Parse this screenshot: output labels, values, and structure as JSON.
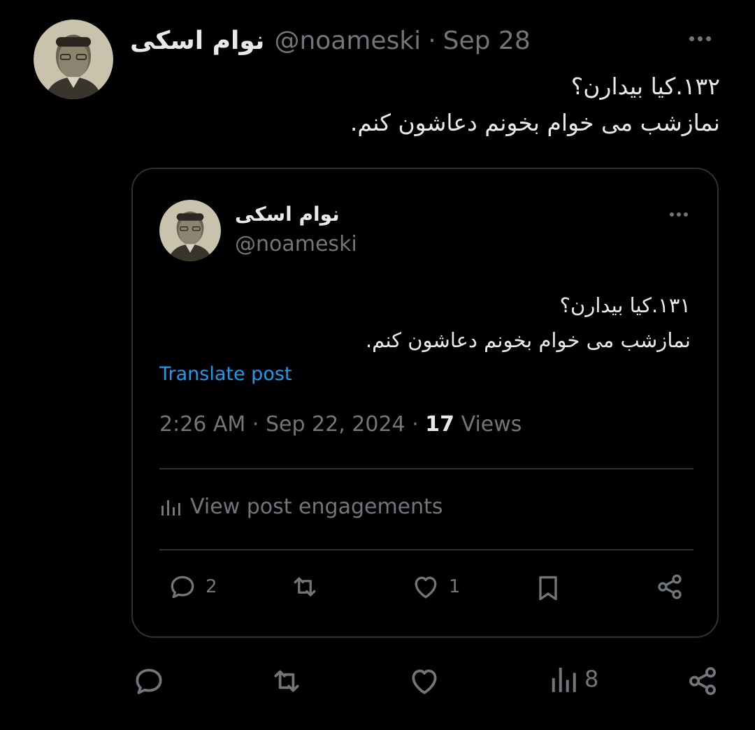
{
  "tweet": {
    "display_name": "نوام اسکی",
    "handle": "@noameski",
    "separator": "·",
    "date": "Sep 28",
    "text_lines": [
      "۱۳۲.کیا بیدارن؟",
      "نمازشب می خوام بخونم دعاشون کنم."
    ],
    "actions": {
      "reply_count": "",
      "retweet_count": "",
      "like_count": "",
      "views_count": "8"
    }
  },
  "quote": {
    "display_name": "نوام اسکی",
    "handle": "@noameski",
    "text_lines": [
      "۱۳۱.کیا بیدارن؟",
      "نمازشب می خوام بخونم دعاشون کنم."
    ],
    "translate_label": "Translate post",
    "time": "2:26 AM",
    "separator": "·",
    "date": "Sep 22, 2024",
    "views_count": "17",
    "views_label": "Views",
    "engagements_label": "View post engagements",
    "actions": {
      "reply_count": "2",
      "like_count": "1"
    }
  },
  "icons": {
    "more": "more-dots-icon",
    "reply": "reply-bubble-icon",
    "retweet": "retweet-icon",
    "like": "heart-icon",
    "bookmark": "bookmark-icon",
    "share": "share-icon",
    "views": "bar-chart-icon"
  },
  "colors": {
    "background": "#000000",
    "text": "#e7e9ea",
    "muted": "#71767b",
    "link": "#1d9bf0",
    "border": "#2f3336"
  }
}
